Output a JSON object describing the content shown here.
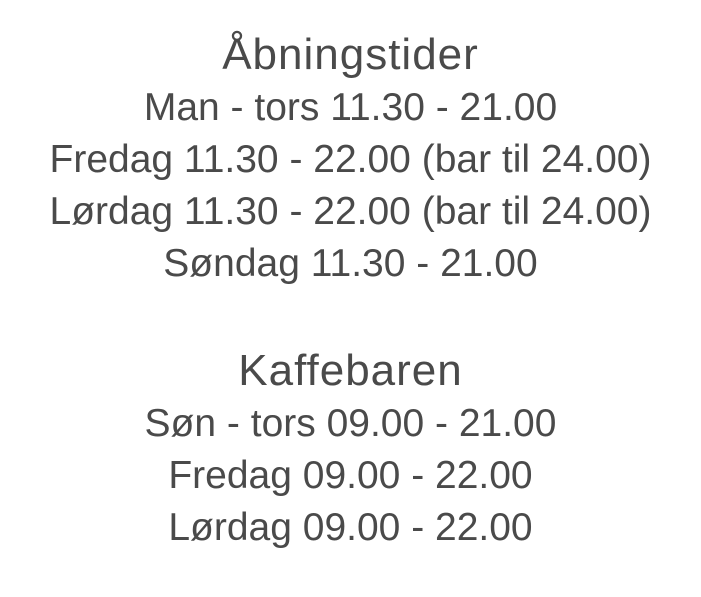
{
  "opening_hours": {
    "title": "Åbningstider",
    "lines": [
      "Man - tors 11.30 - 21.00",
      "Fredag 11.30 - 22.00 (bar til 24.00)",
      "Lørdag 11.30 - 22.00 (bar til 24.00)",
      "Søndag 11.30 - 21.00"
    ]
  },
  "coffee_bar": {
    "title": "Kaffebaren",
    "lines": [
      "Søn - tors 09.00 - 21.00",
      "Fredag 09.00 - 22.00",
      "Lørdag 09.00 - 22.00"
    ]
  },
  "colors": {
    "text": "#4a4a4a",
    "background": "#ffffff"
  }
}
